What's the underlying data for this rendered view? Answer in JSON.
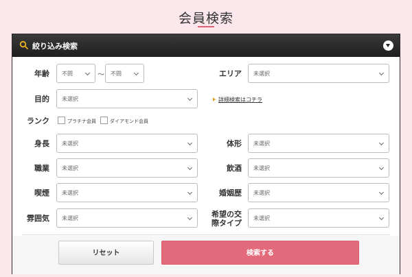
{
  "page_title": "会員検索",
  "panel": {
    "header_label": "絞り込み検索"
  },
  "fields": {
    "age_label": "年齢",
    "age_from": "不問",
    "age_tilde": "〜",
    "age_to": "不問",
    "area_label": "エリア",
    "area_value": "未選択",
    "purpose_label": "目的",
    "purpose_value": "未選択",
    "detail_link": "詳細検索はコチラ",
    "rank_label": "ランク",
    "rank_options": [
      "プラチナ会員",
      "ダイアモンド会員"
    ],
    "height_label": "身長",
    "height_value": "未選択",
    "body_label": "体形",
    "body_value": "未選択",
    "job_label": "職業",
    "job_value": "未選択",
    "drink_label": "飲酒",
    "drink_value": "未選択",
    "smoke_label": "喫煙",
    "smoke_value": "未選択",
    "marriage_label": "婚姻歴",
    "marriage_value": "未選択",
    "mood_label": "雰囲気",
    "mood_value": "未選択",
    "relation_label_1": "希望の交",
    "relation_label_2": "際タイプ",
    "relation_value": "未選択"
  },
  "buttons": {
    "reset": "リセット",
    "search": "検索する"
  },
  "colors": {
    "background": "#fce8ec",
    "accent": "#e36a7b",
    "header": "#222222",
    "link_arrow": "#e0a020"
  },
  "icons": {
    "header_search": "search-icon",
    "header_toggle": "chevron-down-circle-icon",
    "select_arrow": "chevron-down-icon",
    "link_arrow": "triangle-right-icon"
  }
}
